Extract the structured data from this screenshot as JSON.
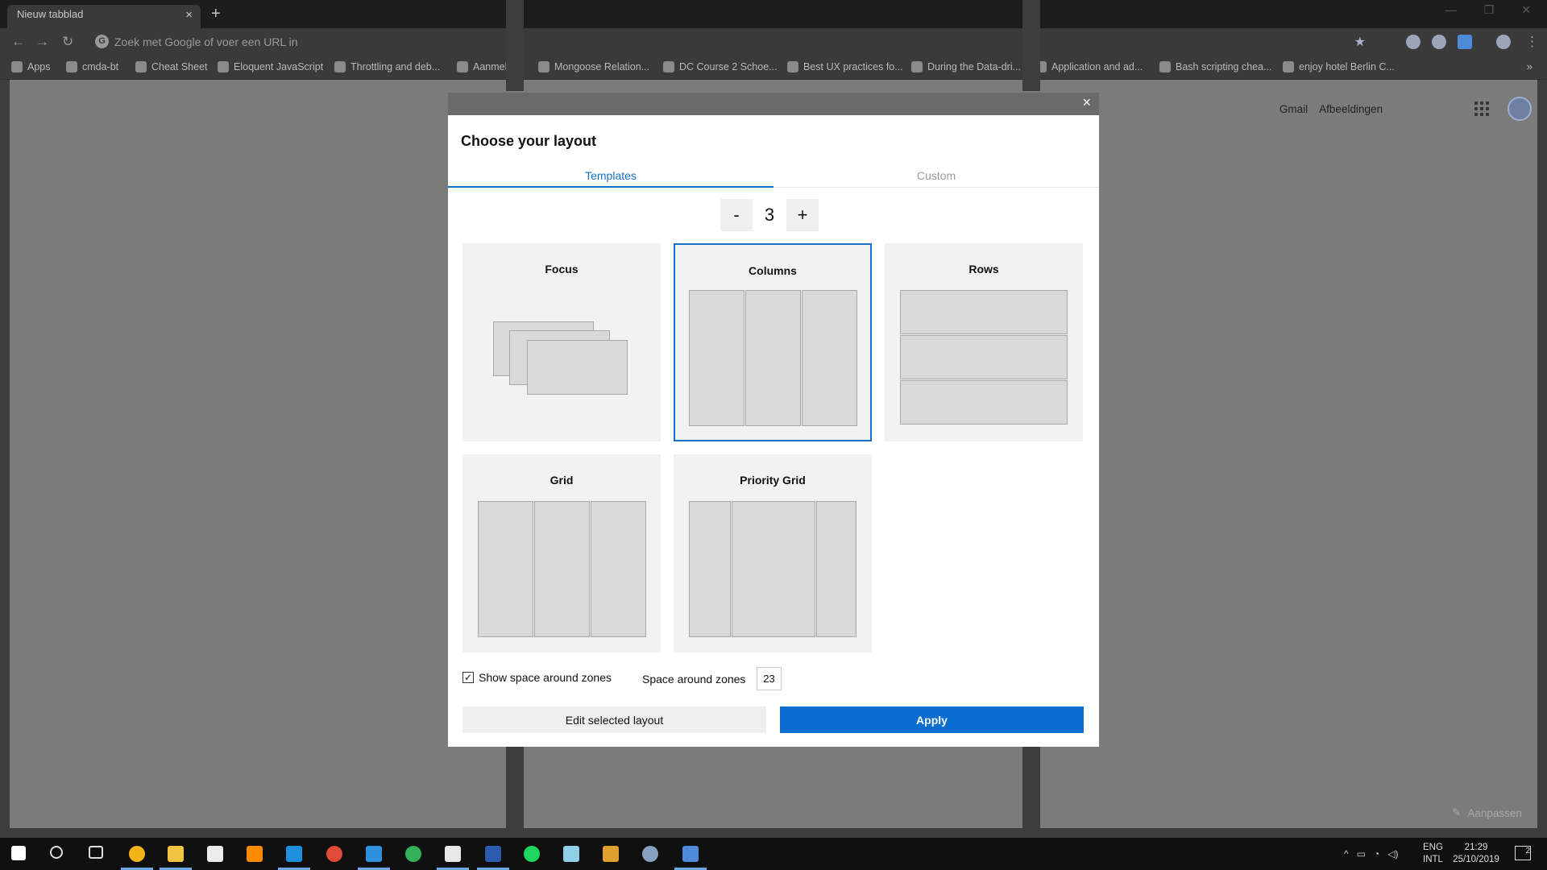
{
  "browser": {
    "tab_title": "Nieuw tabblad",
    "tab_close": "×",
    "new_tab": "+",
    "omnibox_placeholder": "Zoek met Google of voer een URL in",
    "bookmarks": [
      {
        "label": "Apps"
      },
      {
        "label": "cmda-bt"
      },
      {
        "label": "Cheat Sheet"
      },
      {
        "label": "Eloquent JavaScript"
      },
      {
        "label": "Throttling and deb..."
      },
      {
        "label": "Aanmelden"
      },
      {
        "label": "Mongoose Relation..."
      },
      {
        "label": "DC Course 2 Schoe..."
      },
      {
        "label": "Best UX practices fo..."
      },
      {
        "label": "During the Data-dri..."
      },
      {
        "label": "Application and ad..."
      },
      {
        "label": "Bash scripting chea..."
      },
      {
        "label": "enjoy hotel Berlin C..."
      }
    ],
    "bookmarks_more": "»"
  },
  "google": {
    "gmail": "Gmail",
    "images": "Afbeeldingen",
    "customize": "Aanpassen"
  },
  "modal": {
    "close": "×",
    "title": "Choose your layout",
    "tabs": [
      {
        "label": "Templates",
        "active": true
      },
      {
        "label": "Custom",
        "active": false
      }
    ],
    "stepper": {
      "minus": "-",
      "value": "3",
      "plus": "+"
    },
    "layouts": [
      {
        "name": "Focus",
        "selected": false
      },
      {
        "name": "Columns",
        "selected": true
      },
      {
        "name": "Rows",
        "selected": false
      },
      {
        "name": "Grid",
        "selected": false
      },
      {
        "name": "Priority Grid",
        "selected": false
      }
    ],
    "show_space_label": "Show space around zones",
    "show_space_checked": true,
    "space_label": "Space around zones",
    "space_value": "23",
    "edit_button": "Edit selected layout",
    "apply_button": "Apply"
  },
  "taskbar": {
    "lang_top": "ENG",
    "lang_bottom": "INTL",
    "time": "21:29",
    "date": "25/10/2019",
    "notifications": "2"
  },
  "colors": {
    "accent": "#0c6dd1",
    "tab_accent": "#1a6fc7"
  }
}
